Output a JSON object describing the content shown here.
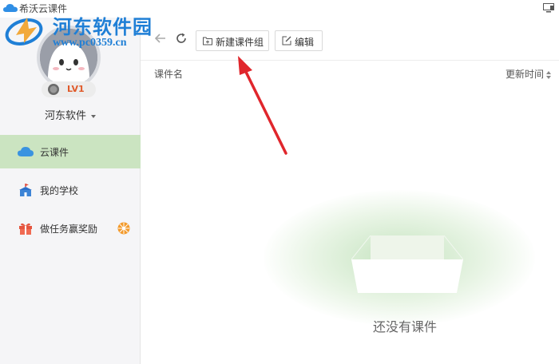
{
  "window": {
    "title": "希沃云课件",
    "brand_color": "#1f7fd6",
    "icons": [
      "cloud-logo-icon",
      "window-layout-icon"
    ]
  },
  "watermark": {
    "title": "河东软件园",
    "url": "www.pc0359.cn"
  },
  "user": {
    "level": "LV1",
    "name": "河东软件"
  },
  "sidebar": {
    "items": [
      {
        "label": "云课件",
        "icon": "cloud-icon",
        "active": true
      },
      {
        "label": "我的学校",
        "icon": "school-icon",
        "active": false
      },
      {
        "label": "做任务赢奖励",
        "icon": "gift-icon",
        "active": false,
        "badge_icon": "badge-icon"
      }
    ],
    "active_color": "#cbe4c1"
  },
  "toolbar": {
    "new_group_label": "新建课件组",
    "edit_label": "编辑"
  },
  "table": {
    "columns": [
      "课件名",
      "更新时间"
    ]
  },
  "empty_state": {
    "message": "还没有课件"
  },
  "annotation": {
    "arrow_color": "#e0262c"
  }
}
